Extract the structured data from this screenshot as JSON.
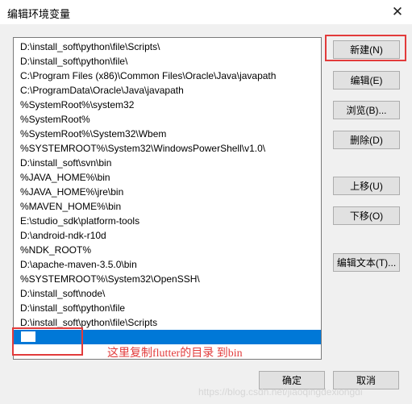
{
  "window": {
    "title": "编辑环境变量",
    "close_glyph": "✕"
  },
  "path_list": {
    "items": [
      "D:\\install_soft\\python\\file\\Scripts\\",
      "D:\\install_soft\\python\\file\\",
      "C:\\Program Files (x86)\\Common Files\\Oracle\\Java\\javapath",
      "C:\\ProgramData\\Oracle\\Java\\javapath",
      "%SystemRoot%\\system32",
      "%SystemRoot%",
      "%SystemRoot%\\System32\\Wbem",
      "%SYSTEMROOT%\\System32\\WindowsPowerShell\\v1.0\\",
      "D:\\install_soft\\svn\\bin",
      "%JAVA_HOME%\\bin",
      "%JAVA_HOME%\\jre\\bin",
      "%MAVEN_HOME%\\bin",
      "E:\\studio_sdk\\platform-tools",
      "D:\\android-ndk-r10d",
      "%NDK_ROOT%",
      "D:\\apache-maven-3.5.0\\bin",
      "%SYSTEMROOT%\\System32\\OpenSSH\\",
      "D:\\install_soft\\node\\",
      "D:\\install_soft\\python\\file",
      "D:\\install_soft\\python\\file\\Scripts"
    ],
    "new_entry_value": ""
  },
  "buttons": {
    "new": "新建(N)",
    "edit": "编辑(E)",
    "browse": "浏览(B)...",
    "delete": "删除(D)",
    "move_up": "上移(U)",
    "move_down": "下移(O)",
    "edit_text": "编辑文本(T)...",
    "ok": "确定",
    "cancel": "取消"
  },
  "annotation": {
    "text": "这里复制flutter的目录 到bin"
  },
  "watermark": {
    "text": "https://blog.csdn.net/jiaoqingdexiongdi"
  },
  "colors": {
    "selection": "#0078d7",
    "annotation_red": "#e23b3b",
    "button_face": "#e1e1e1",
    "dialog_bg": "#f0f0f0"
  }
}
